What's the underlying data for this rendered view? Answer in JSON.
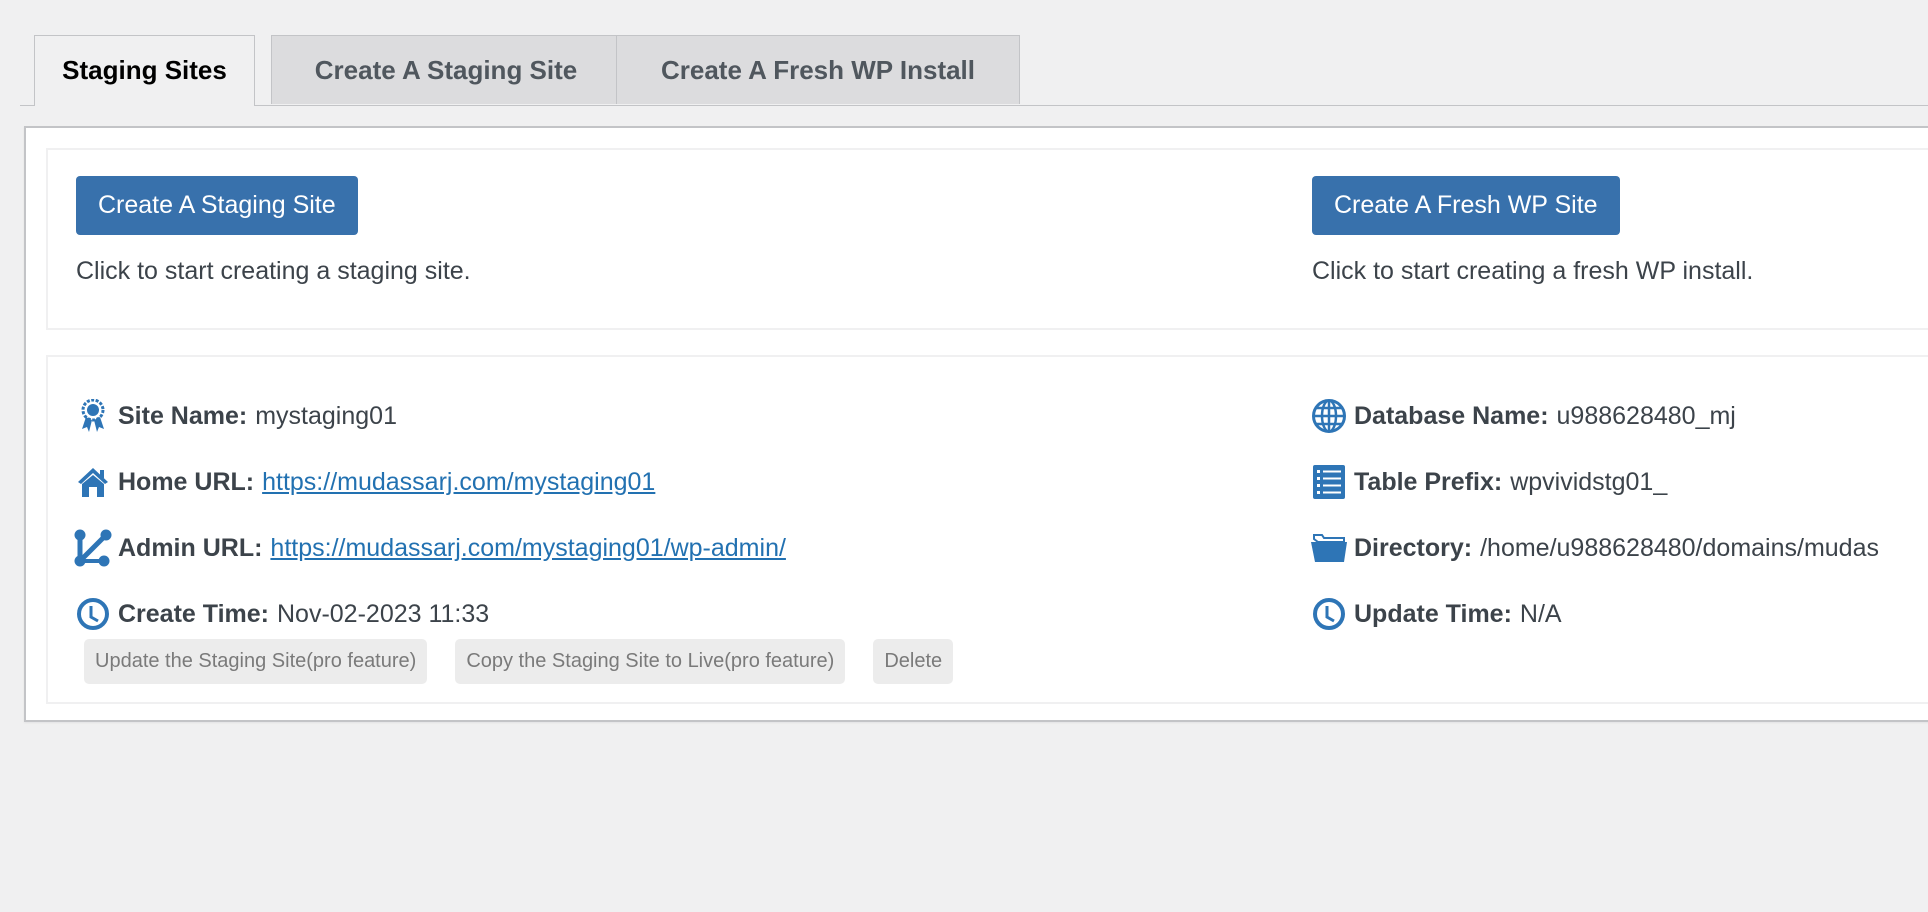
{
  "tabs": [
    {
      "label": "Staging Sites",
      "active": true
    },
    {
      "label": "Create A Staging Site",
      "active": false
    },
    {
      "label": "Create A Fresh WP Install",
      "active": false
    }
  ],
  "create": {
    "staging": {
      "button_label": "Create A Staging Site",
      "description": "Click to start creating a staging site."
    },
    "fresh": {
      "button_label": "Create A Fresh WP Site",
      "description": "Click to start creating a fresh WP install."
    }
  },
  "site": {
    "left": [
      {
        "icon": "award-icon",
        "label": "Site Name:",
        "value": "mystaging01",
        "link": false
      },
      {
        "icon": "home-icon",
        "label": "Home URL:",
        "value": "https://mudassarj.com/mystaging01",
        "link": true
      },
      {
        "icon": "admin-link-icon",
        "label": "Admin URL:",
        "value": "https://mudassarj.com/mystaging01/wp-admin/",
        "link": true
      },
      {
        "icon": "clock-icon",
        "label": "Create Time:",
        "value": "Nov-02-2023 11:33",
        "link": false
      }
    ],
    "right": [
      {
        "icon": "globe-icon",
        "label": "Database Name:",
        "value": "u988628480_mj"
      },
      {
        "icon": "list-icon",
        "label": "Table Prefix:",
        "value": "wpvividstg01_"
      },
      {
        "icon": "folder-open-icon",
        "label": "Directory:",
        "value": "/home/u988628480/domains/mudas"
      },
      {
        "icon": "clock-icon",
        "label": "Update Time:",
        "value": "N/A"
      }
    ],
    "actions": [
      {
        "label": "Update the Staging Site(pro feature)",
        "disabled": true
      },
      {
        "label": "Copy the Staging Site to Live(pro feature)",
        "disabled": true
      },
      {
        "label": "Delete",
        "disabled": true
      }
    ]
  },
  "colors": {
    "primary_button": "#3871ac",
    "link": "#2271b1",
    "icon": "#2e75b6",
    "background": "#f0f0f1"
  }
}
